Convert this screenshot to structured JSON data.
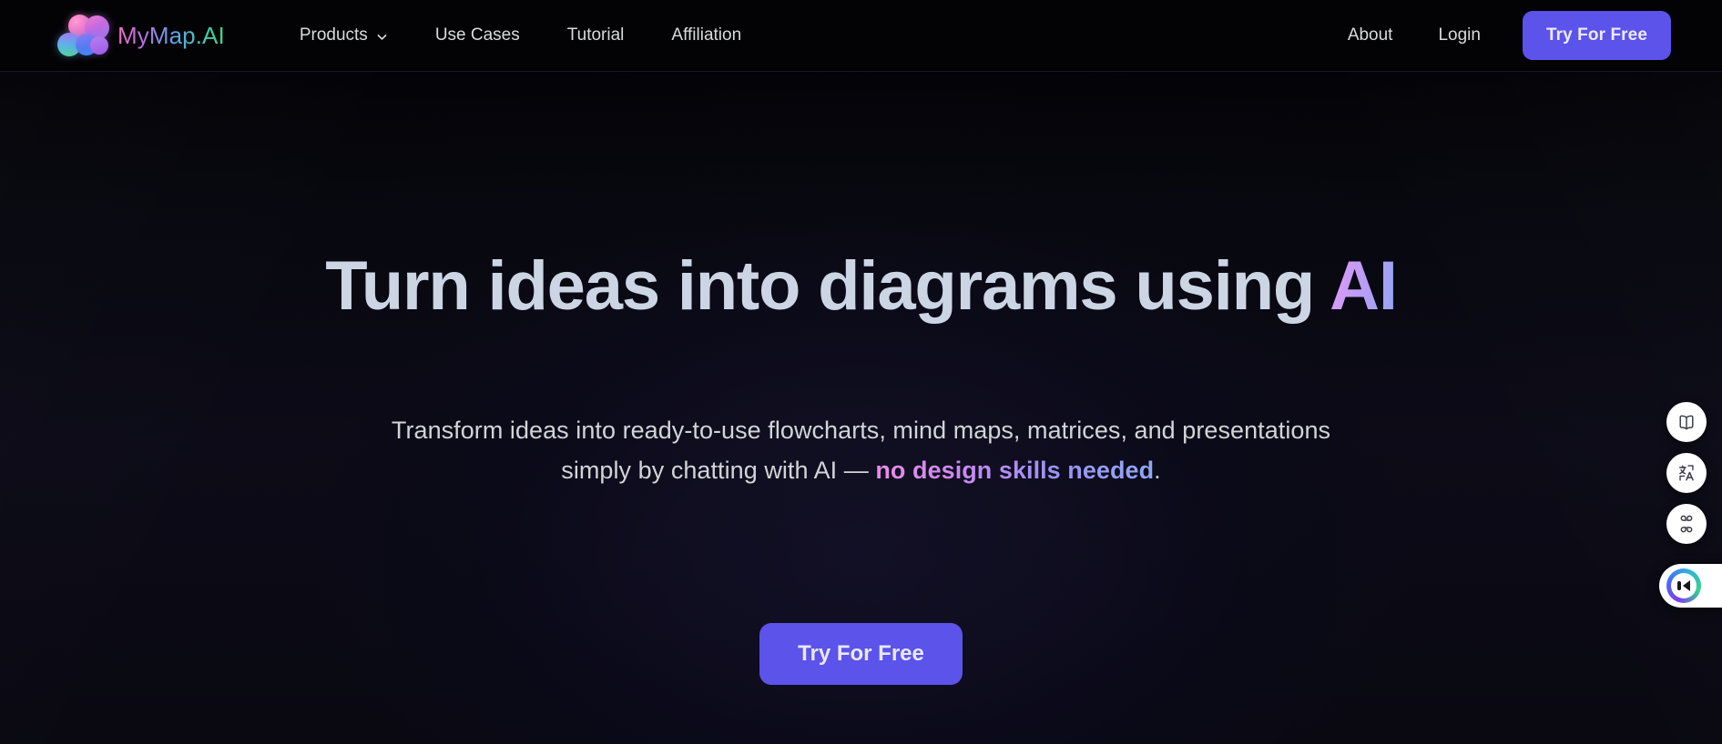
{
  "brand": {
    "name": "MyMap.AI",
    "logo_icon": "mymap-blob-cluster-icon"
  },
  "nav": {
    "links": [
      {
        "label": "Products",
        "has_dropdown": true,
        "icon": "chevron-down-icon"
      },
      {
        "label": "Use Cases",
        "has_dropdown": false
      },
      {
        "label": "Tutorial",
        "has_dropdown": false
      },
      {
        "label": "Affiliation",
        "has_dropdown": false
      }
    ],
    "right_links": [
      {
        "label": "About"
      },
      {
        "label": "Login"
      }
    ],
    "cta_label": "Try For Free"
  },
  "hero": {
    "headline_plain": "Turn ideas into diagrams using ",
    "headline_accent": "AI",
    "subhead_line1": "Transform ideas into ready-to-use flowcharts, mind maps, matrices, and presentations",
    "subhead_line2_plain": "simply by chatting with AI — ",
    "subhead_line2_accent": "no design skills needed",
    "subhead_line2_tail": ".",
    "cta_label": "Try For Free"
  },
  "side_dock": {
    "buttons": [
      {
        "icon": "book-open-icon",
        "name": "docs-button"
      },
      {
        "icon": "translate-icon",
        "name": "language-button"
      },
      {
        "icon": "apps-grid-icon",
        "name": "apps-button"
      }
    ],
    "chat_widget": {
      "icon": "chat-assistant-icon",
      "name": "chat-widget"
    }
  },
  "colors": {
    "accent_button": "#5b53ea",
    "nav_background": "#030305",
    "hero_background": "#0c0b17",
    "headline_text": "#ccd5e3",
    "subhead_text": "#d3d4d7",
    "gradient_ai_start": "#e49cf5",
    "gradient_ai_end": "#8fa6f3"
  }
}
